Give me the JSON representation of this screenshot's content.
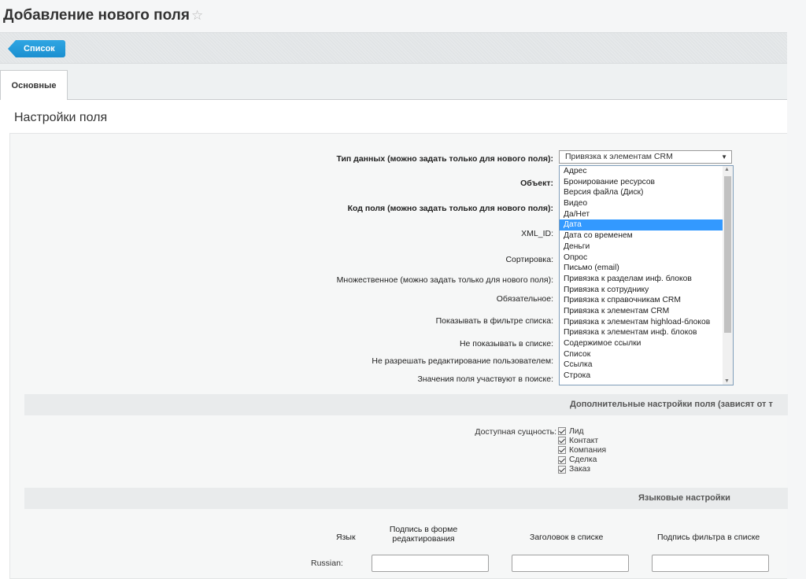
{
  "page": {
    "title": "Добавление нового поля"
  },
  "toolbar": {
    "list_label": "Список"
  },
  "tabs": [
    {
      "label": "Основные"
    }
  ],
  "section": {
    "title": "Настройки поля"
  },
  "fields": {
    "data_type_label": "Тип данных (можно задать только для нового поля):",
    "object_label": "Объект:",
    "field_code_label": "Код поля (можно задать только для нового поля):",
    "xml_id_label": "XML_ID:",
    "sort_label": "Сортировка:",
    "multiple_label": "Множественное (можно задать только для нового поля):",
    "required_label": "Обязательное:",
    "show_filter_label": "Показывать в фильтре списка:",
    "hide_list_label": "Не показывать в списке:",
    "no_edit_label": "Не разрешать редактирование пользователем:",
    "search_label": "Значения поля участвуют в поиске:"
  },
  "data_type_select": {
    "value": "Привязка к элементам CRM",
    "options": [
      "Адрес",
      "Бронирование ресурсов",
      "Версия файла (Диск)",
      "Видео",
      "Да/Нет",
      "Дата",
      "Дата со временем",
      "Деньги",
      "Опрос",
      "Письмо (email)",
      "Привязка к разделам инф. блоков",
      "Привязка к сотруднику",
      "Привязка к справочникам CRM",
      "Привязка к элементам CRM",
      "Привязка к элементам highload-блоков",
      "Привязка к элементам инф. блоков",
      "Содержимое ссылки",
      "Список",
      "Ссылка",
      "Строка"
    ],
    "highlighted": "Дата"
  },
  "extra": {
    "title": "Дополнительные настройки поля (зависят от т",
    "entity_label": "Доступная сущность:",
    "entities": [
      "Лид",
      "Контакт",
      "Компания",
      "Сделка",
      "Заказ"
    ]
  },
  "language": {
    "title": "Языковые настройки",
    "col_lang": "Язык",
    "col_edit_form": "Подпись в форме редактирования",
    "col_list_header": "Заголовок в списке",
    "col_filter": "Подпись фильтра в списке",
    "row_lang": "Russian:"
  }
}
